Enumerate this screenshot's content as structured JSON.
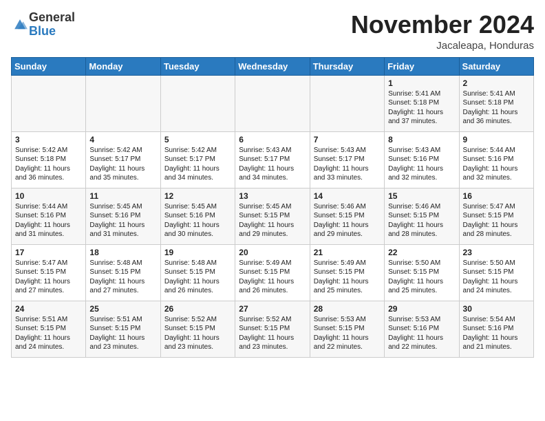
{
  "logo": {
    "general": "General",
    "blue": "Blue"
  },
  "header": {
    "month": "November 2024",
    "location": "Jacaleapa, Honduras"
  },
  "weekdays": [
    "Sunday",
    "Monday",
    "Tuesday",
    "Wednesday",
    "Thursday",
    "Friday",
    "Saturday"
  ],
  "weeks": [
    [
      {
        "day": "",
        "info": ""
      },
      {
        "day": "",
        "info": ""
      },
      {
        "day": "",
        "info": ""
      },
      {
        "day": "",
        "info": ""
      },
      {
        "day": "",
        "info": ""
      },
      {
        "day": "1",
        "info": "Sunrise: 5:41 AM\nSunset: 5:18 PM\nDaylight: 11 hours\nand 37 minutes."
      },
      {
        "day": "2",
        "info": "Sunrise: 5:41 AM\nSunset: 5:18 PM\nDaylight: 11 hours\nand 36 minutes."
      }
    ],
    [
      {
        "day": "3",
        "info": "Sunrise: 5:42 AM\nSunset: 5:18 PM\nDaylight: 11 hours\nand 36 minutes."
      },
      {
        "day": "4",
        "info": "Sunrise: 5:42 AM\nSunset: 5:17 PM\nDaylight: 11 hours\nand 35 minutes."
      },
      {
        "day": "5",
        "info": "Sunrise: 5:42 AM\nSunset: 5:17 PM\nDaylight: 11 hours\nand 34 minutes."
      },
      {
        "day": "6",
        "info": "Sunrise: 5:43 AM\nSunset: 5:17 PM\nDaylight: 11 hours\nand 34 minutes."
      },
      {
        "day": "7",
        "info": "Sunrise: 5:43 AM\nSunset: 5:17 PM\nDaylight: 11 hours\nand 33 minutes."
      },
      {
        "day": "8",
        "info": "Sunrise: 5:43 AM\nSunset: 5:16 PM\nDaylight: 11 hours\nand 32 minutes."
      },
      {
        "day": "9",
        "info": "Sunrise: 5:44 AM\nSunset: 5:16 PM\nDaylight: 11 hours\nand 32 minutes."
      }
    ],
    [
      {
        "day": "10",
        "info": "Sunrise: 5:44 AM\nSunset: 5:16 PM\nDaylight: 11 hours\nand 31 minutes."
      },
      {
        "day": "11",
        "info": "Sunrise: 5:45 AM\nSunset: 5:16 PM\nDaylight: 11 hours\nand 31 minutes."
      },
      {
        "day": "12",
        "info": "Sunrise: 5:45 AM\nSunset: 5:16 PM\nDaylight: 11 hours\nand 30 minutes."
      },
      {
        "day": "13",
        "info": "Sunrise: 5:45 AM\nSunset: 5:15 PM\nDaylight: 11 hours\nand 29 minutes."
      },
      {
        "day": "14",
        "info": "Sunrise: 5:46 AM\nSunset: 5:15 PM\nDaylight: 11 hours\nand 29 minutes."
      },
      {
        "day": "15",
        "info": "Sunrise: 5:46 AM\nSunset: 5:15 PM\nDaylight: 11 hours\nand 28 minutes."
      },
      {
        "day": "16",
        "info": "Sunrise: 5:47 AM\nSunset: 5:15 PM\nDaylight: 11 hours\nand 28 minutes."
      }
    ],
    [
      {
        "day": "17",
        "info": "Sunrise: 5:47 AM\nSunset: 5:15 PM\nDaylight: 11 hours\nand 27 minutes."
      },
      {
        "day": "18",
        "info": "Sunrise: 5:48 AM\nSunset: 5:15 PM\nDaylight: 11 hours\nand 27 minutes."
      },
      {
        "day": "19",
        "info": "Sunrise: 5:48 AM\nSunset: 5:15 PM\nDaylight: 11 hours\nand 26 minutes."
      },
      {
        "day": "20",
        "info": "Sunrise: 5:49 AM\nSunset: 5:15 PM\nDaylight: 11 hours\nand 26 minutes."
      },
      {
        "day": "21",
        "info": "Sunrise: 5:49 AM\nSunset: 5:15 PM\nDaylight: 11 hours\nand 25 minutes."
      },
      {
        "day": "22",
        "info": "Sunrise: 5:50 AM\nSunset: 5:15 PM\nDaylight: 11 hours\nand 25 minutes."
      },
      {
        "day": "23",
        "info": "Sunrise: 5:50 AM\nSunset: 5:15 PM\nDaylight: 11 hours\nand 24 minutes."
      }
    ],
    [
      {
        "day": "24",
        "info": "Sunrise: 5:51 AM\nSunset: 5:15 PM\nDaylight: 11 hours\nand 24 minutes."
      },
      {
        "day": "25",
        "info": "Sunrise: 5:51 AM\nSunset: 5:15 PM\nDaylight: 11 hours\nand 23 minutes."
      },
      {
        "day": "26",
        "info": "Sunrise: 5:52 AM\nSunset: 5:15 PM\nDaylight: 11 hours\nand 23 minutes."
      },
      {
        "day": "27",
        "info": "Sunrise: 5:52 AM\nSunset: 5:15 PM\nDaylight: 11 hours\nand 23 minutes."
      },
      {
        "day": "28",
        "info": "Sunrise: 5:53 AM\nSunset: 5:15 PM\nDaylight: 11 hours\nand 22 minutes."
      },
      {
        "day": "29",
        "info": "Sunrise: 5:53 AM\nSunset: 5:16 PM\nDaylight: 11 hours\nand 22 minutes."
      },
      {
        "day": "30",
        "info": "Sunrise: 5:54 AM\nSunset: 5:16 PM\nDaylight: 11 hours\nand 21 minutes."
      }
    ]
  ]
}
